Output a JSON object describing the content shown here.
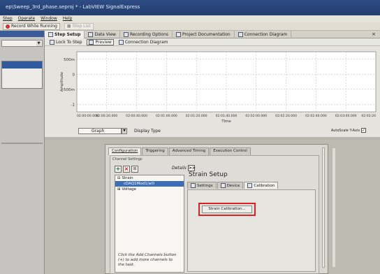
{
  "window": {
    "title": "ep\\Sweep_3rd_phase.seproj * - LabVIEW SignalExpress"
  },
  "menubar": {
    "items": [
      "Step",
      "Operate",
      "Window",
      "Help"
    ]
  },
  "toolbar": {
    "record_label": "Record While Running",
    "stop_label": "Stop List"
  },
  "tabs": [
    {
      "label": "Step Setup",
      "active": true
    },
    {
      "label": "Data View",
      "active": false
    },
    {
      "label": "Recording Options",
      "active": false
    },
    {
      "label": "Project Documentation",
      "active": false
    },
    {
      "label": "Connection Diagram",
      "active": false
    }
  ],
  "subtoolbar": {
    "lock_label": "Lock To Step",
    "preview_label": "Preview",
    "connection_label": "Connection Diagram"
  },
  "chart_data": {
    "type": "line",
    "xlabel": "Time",
    "ylabel": "Amplitude",
    "y_ticks": [
      "500m",
      "0",
      "-500m",
      "-1"
    ],
    "x_ticks": [
      "02:00:00.000",
      "02:00:20.000",
      "02:00:40.000",
      "02:01:00.000",
      "02:01:20.000",
      "02:01:40.000",
      "02:02:00.000",
      "02:02:20.000",
      "02:02:40.000",
      "02:03:00.000",
      "02:03:20"
    ],
    "ylim": [
      -1,
      1
    ],
    "grid": true,
    "series": []
  },
  "graph_controls": {
    "display_value": "Graph",
    "display_type_label": "Display Type",
    "autoscale_label": "AutoScale Y-Axis",
    "autoscale_checked": true
  },
  "config": {
    "tabs": [
      "Configuration",
      "Triggering",
      "Advanced Timing",
      "Execution Control"
    ],
    "channel_settings_label": "Channel Settings",
    "details_label": "Details",
    "details_button": ">>",
    "tree": [
      {
        "label": "Strain",
        "selected": false,
        "prefix": "⊟"
      },
      {
        "label": "cDAQ1Mod1/ai0",
        "selected": true,
        "prefix": ""
      },
      {
        "label": "Voltage",
        "selected": false,
        "prefix": "⊞"
      }
    ],
    "hint": "Click the Add Channels button (+) to add more channels to the task.",
    "strain_setup_title": "Strain Setup",
    "inner_tabs": [
      "Settings",
      "Device",
      "Calibration"
    ],
    "strain_calibration_label": "Strain Calibration..."
  }
}
